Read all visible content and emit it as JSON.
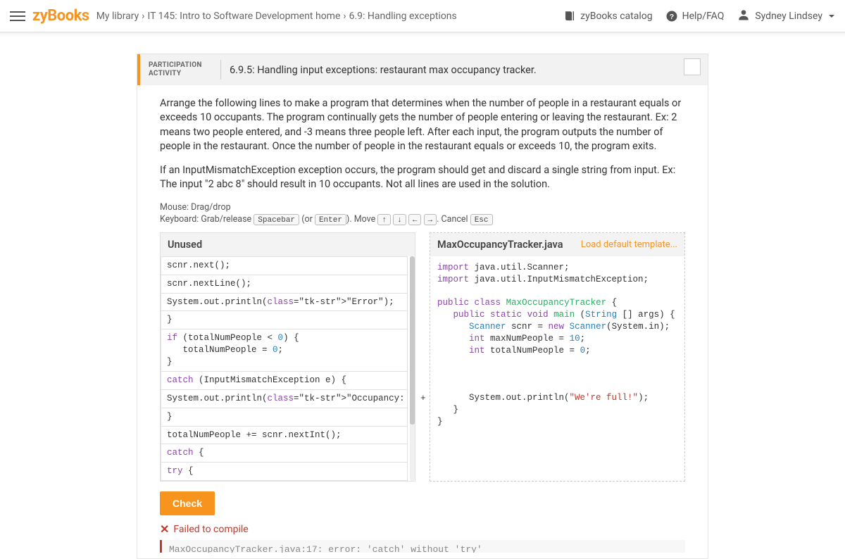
{
  "header": {
    "logo": "zyBooks",
    "breadcrumbs": [
      "My library",
      "IT 145: Intro to Software Development home",
      "6.9: Handling exceptions"
    ],
    "catalog": "zyBooks catalog",
    "help": "Help/FAQ",
    "user": "Sydney Lindsey"
  },
  "activity": {
    "badge_line1": "PARTICIPATION",
    "badge_line2": "ACTIVITY",
    "title": "6.9.5: Handling input exceptions: restaurant max occupancy tracker.",
    "desc1": "Arrange the following lines to make a program that determines when the number of people in a restaurant equals or exceeds 10 occupants. The program continually gets the number of people entering or leaving the restaurant. Ex: 2 means two people entered, and -3 means three people left. After each input, the program outputs the number of people in the restaurant. Once the number of people in the restaurant equals or exceeds 10, the program exits.",
    "desc2": "If an InputMismatchException exception occurs, the program should get and discard a single string from input. Ex: The input \"2 abc 8\" should result in 10 occupants. Not all lines are used in the solution.",
    "hint_mouse": "Mouse: Drag/drop",
    "hint_kb_prefix": "Keyboard: Grab/release ",
    "hint_kb_or": " (or ",
    "hint_kb_move": "). Move ",
    "hint_kb_cancel": ". Cancel ",
    "kbd": {
      "space": "Spacebar",
      "enter": "Enter",
      "up": "↑",
      "down": "↓",
      "left": "←",
      "right": "→",
      "esc": "Esc"
    }
  },
  "unused_header": "Unused",
  "drag_items": [
    "scnr.next();",
    "scnr.nextLine();",
    "System.out.println(\"Error\");",
    "}",
    "if (totalNumPeople < 0) {\n   totalNumPeople = 0;\n}",
    "catch (InputMismatchException e) {",
    "System.out.println(\"Occupancy: \" + totalNumPeople);",
    "}",
    "totalNumPeople += scnr.nextInt();",
    "catch {",
    "try {"
  ],
  "file_header": "MaxOccupancyTracker.java",
  "load_default": "Load default template...",
  "code_tokens": {
    "import": "import",
    "java_util_scanner": "java.util.Scanner",
    "java_util_ime": "java.util.InputMismatchException",
    "public": "public",
    "class": "class",
    "classname": "MaxOccupancyTracker",
    "static": "static",
    "void": "void",
    "main": "main",
    "string": "String",
    "args": "args",
    "scanner": "Scanner",
    "scnr": "scnr",
    "new": "new",
    "system_in": "System.in",
    "int": "int",
    "maxnum": "maxNumPeople",
    "ten": "10",
    "totalnum": "totalNumPeople",
    "zero": "0",
    "sout": "System.out.println",
    "full_str": "\"We're full!\""
  },
  "check_label": "Check",
  "fail_label": "Failed to compile",
  "error_line": "MaxOccupancyTracker.java:17: error: 'catch' without 'try'"
}
